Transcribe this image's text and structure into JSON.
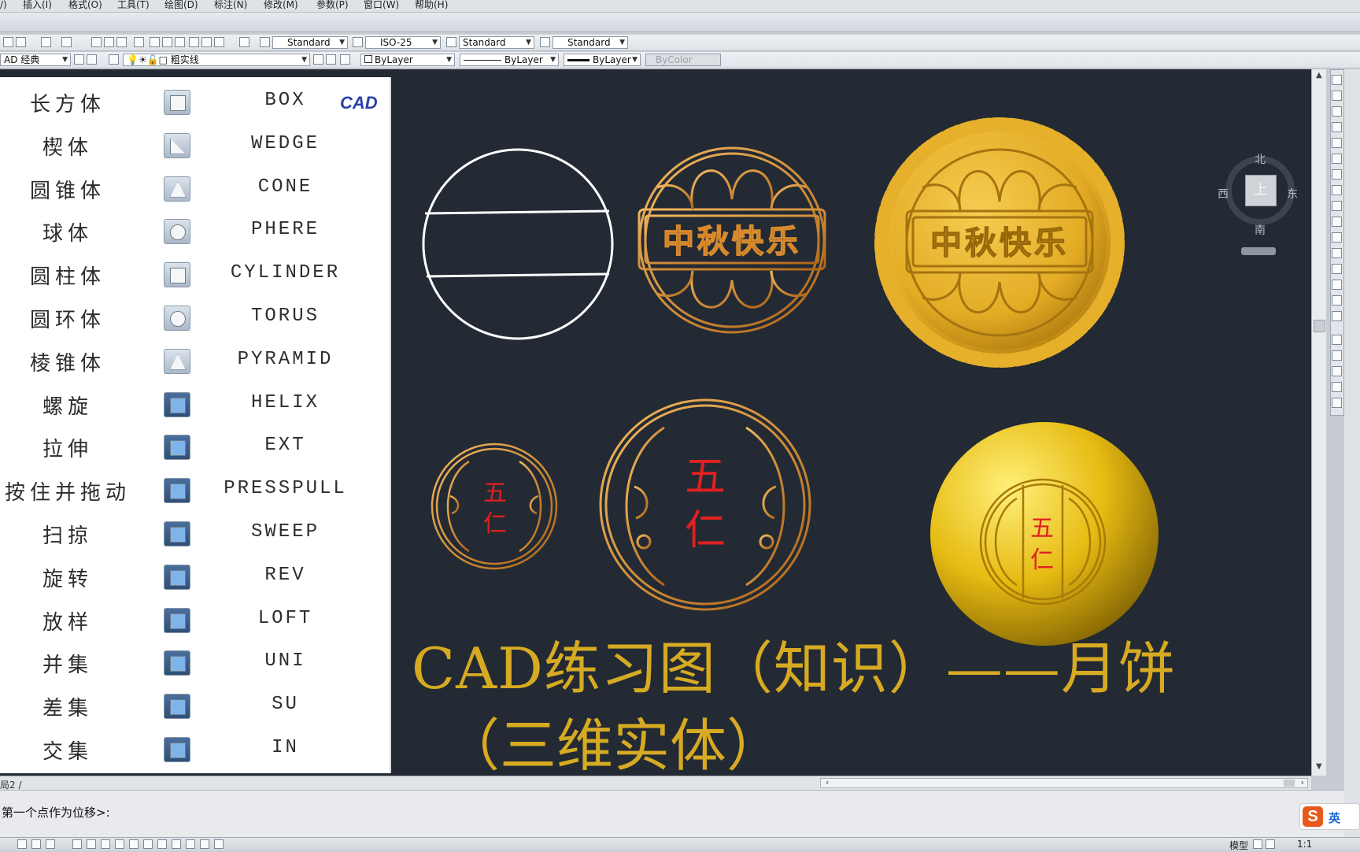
{
  "menubar": {
    "items": [
      "/)",
      "插入(I)",
      "格式(O)",
      "工具(T)",
      "绘图(D)",
      "标注(N)",
      "修改(M)",
      "参数(P)",
      "窗口(W)",
      "帮助(H)"
    ]
  },
  "styles_toolbar": {
    "text_style": "Standard",
    "dim_style": "ISO-25",
    "table_style": "Standard",
    "mleader_style": "Standard"
  },
  "layers_toolbar": {
    "workspace": "AD 经典",
    "current_layer": "粗实线",
    "color": "ByLayer",
    "linetype": "ByLayer",
    "lineweight": "ByLayer",
    "plot_style": "ByColor"
  },
  "reference_panel": {
    "logo": "CAD",
    "rows": [
      {
        "cn": "长方体",
        "en": "BOX",
        "icon": "box-icon"
      },
      {
        "cn": "楔体",
        "en": "WEDGE",
        "icon": "wedge-icon"
      },
      {
        "cn": "圆锥体",
        "en": "CONE",
        "icon": "cone-icon"
      },
      {
        "cn": "球体",
        "en": "PHERE",
        "icon": "sphere-icon"
      },
      {
        "cn": "圆柱体",
        "en": "CYLINDER",
        "icon": "cylinder-icon"
      },
      {
        "cn": "圆环体",
        "en": "TORUS",
        "icon": "torus-icon"
      },
      {
        "cn": "棱锥体",
        "en": "PYRAMID",
        "icon": "pyramid-icon"
      },
      {
        "cn": "螺旋",
        "en": "HELIX",
        "icon": "helix-icon"
      },
      {
        "cn": "拉伸",
        "en": "EXT",
        "icon": "extrude-icon"
      },
      {
        "cn": "按住并拖动",
        "en": "PRESSPULL",
        "icon": "presspull-icon"
      },
      {
        "cn": "扫掠",
        "en": "SWEEP",
        "icon": "sweep-icon"
      },
      {
        "cn": "旋转",
        "en": "REV",
        "icon": "revolve-icon"
      },
      {
        "cn": "放样",
        "en": "LOFT",
        "icon": "loft-icon"
      },
      {
        "cn": "并集",
        "en": "UNI",
        "icon": "union-icon"
      },
      {
        "cn": "差集",
        "en": "SU",
        "icon": "subtract-icon"
      },
      {
        "cn": "交集",
        "en": "IN",
        "icon": "intersect-icon"
      }
    ]
  },
  "drawing": {
    "mooncake_text": "中秋快乐",
    "filling_char_1": "五",
    "filling_char_2": "仁",
    "title_line1": "CAD练习图（知识）——月饼",
    "title_line2": "（三维实体）",
    "gold_color": "#d6aa22",
    "red_text_color": "#e02020"
  },
  "viewcube": {
    "north": "北",
    "south": "南",
    "east": "东",
    "west": "西",
    "face": "上"
  },
  "layout_tab": {
    "label": "局2 /"
  },
  "command_line": {
    "text": "第一个点作为位移>:"
  },
  "ime": {
    "label": "英"
  },
  "status_right": {
    "model_label": "模型",
    "scale": "1:1"
  }
}
